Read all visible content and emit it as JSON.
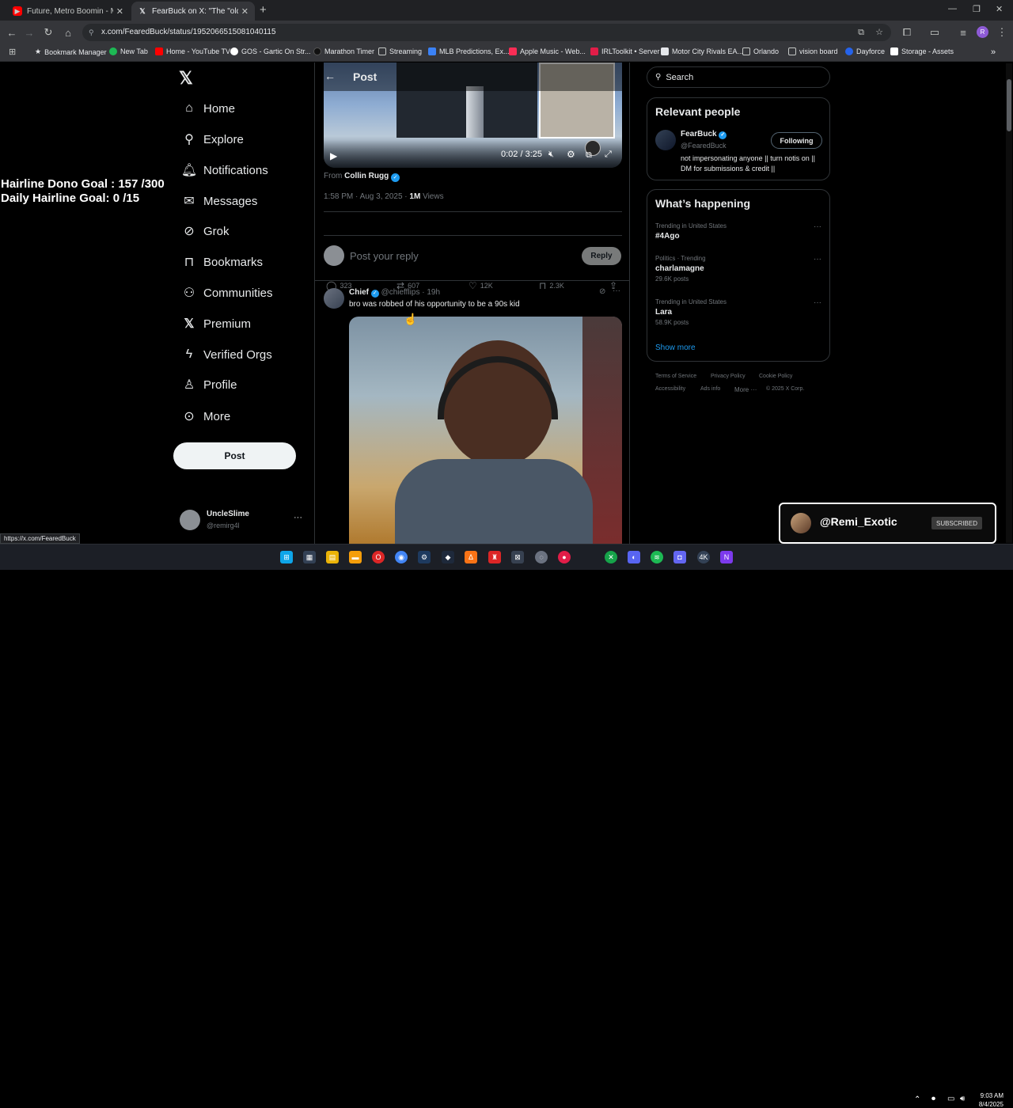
{
  "browser": {
    "tabs": [
      {
        "title": "Future, Metro Boomin - Mile Hi",
        "active": false
      },
      {
        "title": "FearBuck on X: \"The \"oldest bab",
        "active": true
      }
    ],
    "url": "x.com/FearedBuck/status/1952066515081040115",
    "bookmarks": [
      "Bookmark Manager",
      "New Tab",
      "Home - YouTube TV",
      "GOS - Gartic On Str...",
      "Marathon Timer",
      "Streaming",
      "MLB Predictions, Ex...",
      "Apple Music - Web...",
      "IRLToolkit • Server",
      "Motor City Rivals EA...",
      "Orlando",
      "vision board",
      "Dayforce",
      "Storage - Assets"
    ],
    "status_url": "https://x.com/FearedBuck"
  },
  "overlay": {
    "line1": "Hairline Dono Goal : 157 /300",
    "line2": "Daily Hairline Goal: 0  /15"
  },
  "nav": {
    "items": [
      "Home",
      "Explore",
      "Notifications",
      "Messages",
      "Grok",
      "Bookmarks",
      "Communities",
      "Premium",
      "Verified Orgs",
      "Profile",
      "More"
    ],
    "post_button": "Post",
    "account": {
      "name": "UncleSlime",
      "handle": "@remirg4l"
    }
  },
  "post": {
    "header": "Post",
    "video_time": "0:02 / 3:25",
    "from_label": "From",
    "from_name": "Collin Rugg",
    "time": "1:58 PM · Aug 3, 2025 · ",
    "views_count": "1M",
    "views_label": " Views",
    "replies": "323",
    "reposts": "607",
    "likes": "12K",
    "bookmarks": "2.3K",
    "reply_placeholder": "Post your reply",
    "reply_button": "Reply"
  },
  "reply": {
    "name": "Chief",
    "handle": "@chiefflips",
    "age": "· 19h",
    "text": "bro was robbed of his opportunity to be a 90s kid"
  },
  "right": {
    "search_placeholder": "Search",
    "relevant_title": "Relevant people",
    "person": {
      "name": "FearBuck",
      "handle": "@FearedBuck",
      "follow_label": "Following",
      "bio": "not impersonating anyone || turn notis on || DM for submissions & credit ||"
    },
    "happening_title": "What’s happening",
    "trends": [
      {
        "meta": "Trending in United States",
        "name": "#4Ago",
        "posts": ""
      },
      {
        "meta": "Politics · Trending",
        "name": "charlamagne",
        "posts": "29.6K posts"
      },
      {
        "meta": "Trending in United States",
        "name": "Lara",
        "posts": "58.9K posts"
      }
    ],
    "show_more": "Show more",
    "footer": [
      "Terms of Service",
      "Privacy Policy",
      "Cookie Policy",
      "Accessibility",
      "Ads info",
      "More ···",
      "© 2025 X Corp."
    ]
  },
  "subscribe_widget": {
    "name": "@Remi_Exotic",
    "label": "SUBSCRIBED"
  },
  "taskbar": {
    "time": "9:03 AM",
    "date": "8/4/2025"
  },
  "colors": {
    "accent": "#1d9bf0",
    "background": "#000000",
    "muted": "#71767b"
  }
}
